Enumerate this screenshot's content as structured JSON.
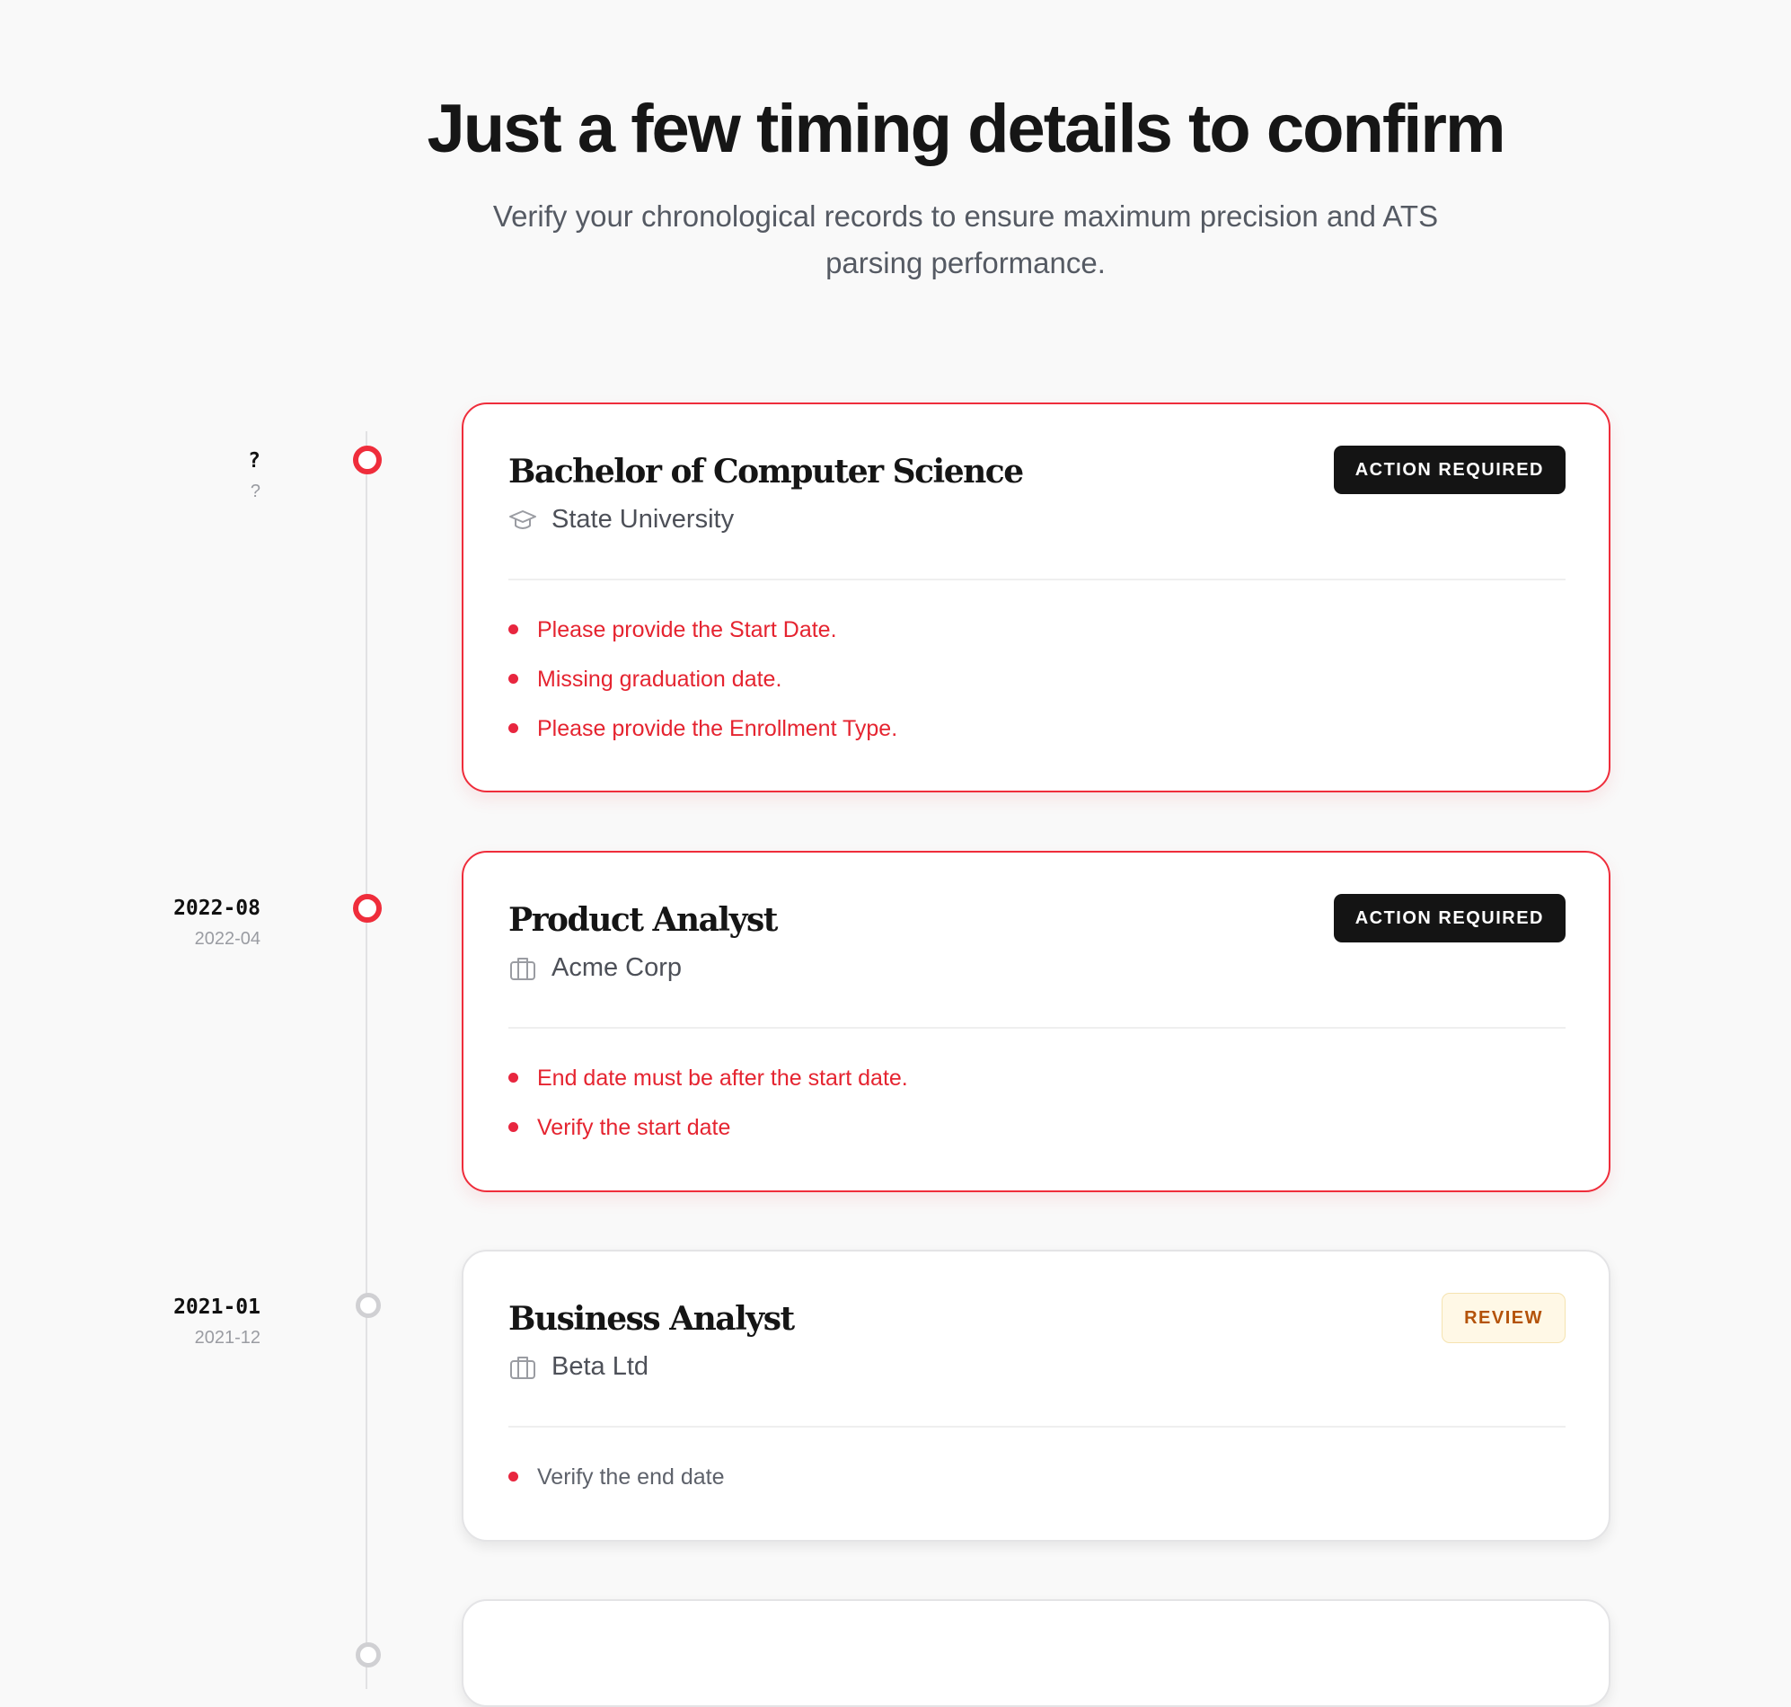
{
  "header": {
    "title": "Just a few timing details to confirm",
    "subtitle": "Verify your chronological records to ensure maximum precision and ATS parsing performance."
  },
  "entries": [
    {
      "date_primary": "?",
      "date_secondary": "?",
      "title": "Bachelor of Computer Science",
      "organization": "State University",
      "org_icon": "graduation-cap-icon",
      "badge": "ACTION REQUIRED",
      "status": "action-required",
      "issues": [
        "Please provide the Start Date.",
        "Missing graduation date.",
        "Please provide the Enrollment Type."
      ]
    },
    {
      "date_primary": "2022-08",
      "date_secondary": "2022-04",
      "title": "Product Analyst",
      "organization": "Acme Corp",
      "org_icon": "briefcase-icon",
      "badge": "ACTION REQUIRED",
      "status": "action-required",
      "issues": [
        "End date must be after the start date.",
        "Verify the start date"
      ]
    },
    {
      "date_primary": "2021-01",
      "date_secondary": "2021-12",
      "title": "Business Analyst",
      "organization": "Beta Ltd",
      "org_icon": "briefcase-icon",
      "badge": "REVIEW",
      "status": "review",
      "issues": [
        "Verify the end date"
      ]
    }
  ],
  "colors": {
    "alert": "#ef2d3b",
    "badge_dark": "#141414",
    "review_text": "#b45309",
    "background": "#f9f9f9"
  }
}
